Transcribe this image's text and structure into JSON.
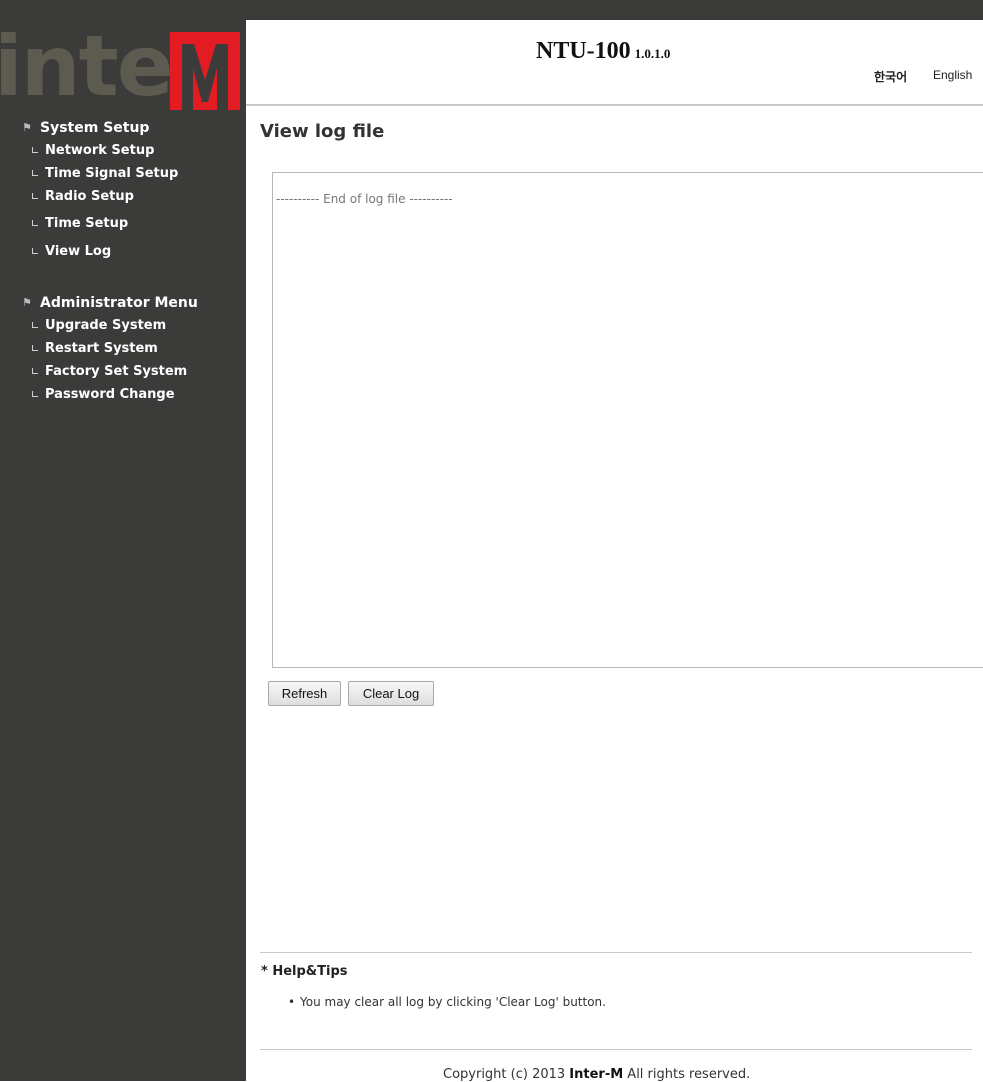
{
  "brand": {
    "logo_text": "interM",
    "logo_main": "inter",
    "logo_mark": "M",
    "colors": {
      "logo_gray": "#5d5a50",
      "logo_red": "#e31c23",
      "sidebar_bg": "#3b3b3a"
    }
  },
  "header": {
    "product": "NTU-100",
    "version": "1.0.1.0",
    "lang_korean": "한국어",
    "lang_english": "English"
  },
  "sidebar": {
    "sections": [
      {
        "title": "System Setup",
        "items": [
          "Network Setup",
          "Time Signal Setup",
          "Radio Setup",
          "Time Setup",
          "View Log"
        ]
      },
      {
        "title": "Administrator Menu",
        "items": [
          "Upgrade System",
          "Restart System",
          "Factory Set System",
          "Password Change"
        ]
      }
    ]
  },
  "main": {
    "title": "View log file",
    "log_text": "---------- End of log file ----------",
    "buttons": {
      "refresh": "Refresh",
      "clear": "Clear Log"
    }
  },
  "help": {
    "title": "* Help&Tips",
    "items": [
      "You may clear all log by clicking 'Clear Log' button."
    ]
  },
  "footer": {
    "prefix": "Copyright (c) 2013 ",
    "company": "Inter-M",
    "suffix": " All rights reserved."
  }
}
